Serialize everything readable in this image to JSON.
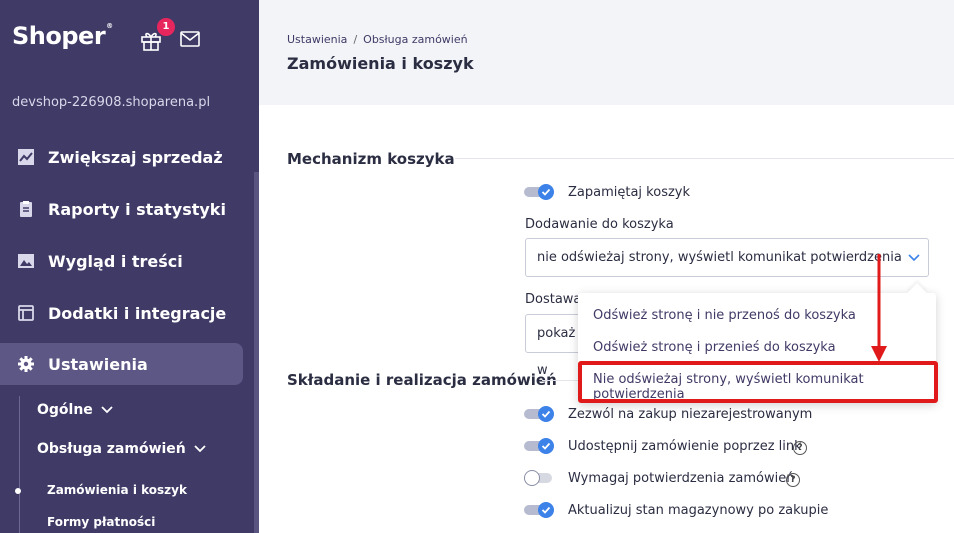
{
  "sidebar": {
    "logo": "Shoper",
    "logo_mark": "®",
    "notification_count": "1",
    "shop_url": "devshop-226908.shoparena.pl",
    "items": [
      {
        "label": "Zwiększaj sprzedaż",
        "icon": "chart-line-icon"
      },
      {
        "label": "Raporty i statystyki",
        "icon": "clipboard-icon"
      },
      {
        "label": "Wygląd i treści",
        "icon": "image-icon"
      },
      {
        "label": "Dodatki i integracje",
        "icon": "window-icon"
      },
      {
        "label": "Ustawienia",
        "icon": "gear-icon",
        "active": true
      }
    ],
    "sub_items": [
      {
        "label": "Ogólne"
      },
      {
        "label": "Obsługa zamówień"
      }
    ],
    "sub_sub_items": [
      {
        "label": "Zamówienia i koszyk",
        "active": true
      },
      {
        "label": "Formy płatności"
      }
    ]
  },
  "header": {
    "breadcrumb": [
      "Ustawienia",
      "Obsługa zamówień"
    ],
    "breadcrumb_sep": "/",
    "title": "Zamówienia i koszyk"
  },
  "cart_section": {
    "title": "Mechanizm koszyka",
    "remember_cart": {
      "label": "Zapamiętaj koszyk",
      "on": true
    },
    "adding": {
      "label": "Dodawanie do koszyka",
      "value": "nie odświeżaj strony, wyświetl komunikat potwierdzenia"
    },
    "shipping": {
      "label": "Dostawa",
      "value": "pokaż w"
    }
  },
  "dropdown": {
    "options": [
      "Odśwież stronę i nie przenoś do koszyka",
      "Odśwież stronę i przenieś do koszyka",
      "Nie odświeżaj strony, wyświetl komunikat potwierdzenia"
    ],
    "highlighted_index": 2
  },
  "orders_section": {
    "title": "Składanie i realizacja zamówień",
    "options": [
      {
        "label": "Zezwól na zakup niezarejestrowanym",
        "on": true,
        "help": false
      },
      {
        "label": "Udostępnij zamówienie poprzez link",
        "on": true,
        "help": true
      },
      {
        "label": "Wymagaj potwierdzenia zamówień",
        "on": false,
        "help": true
      },
      {
        "label": "Aktualizuj stan magazynowy po zakupie",
        "on": true,
        "help": false
      }
    ],
    "help_glyph": "?"
  },
  "colors": {
    "sidebar_bg": "#3f3a66",
    "sidebar_active": "#5c5784",
    "badge": "#e8265e",
    "toggle_on": "#3c82e8",
    "highlight": "#e01a1a"
  }
}
